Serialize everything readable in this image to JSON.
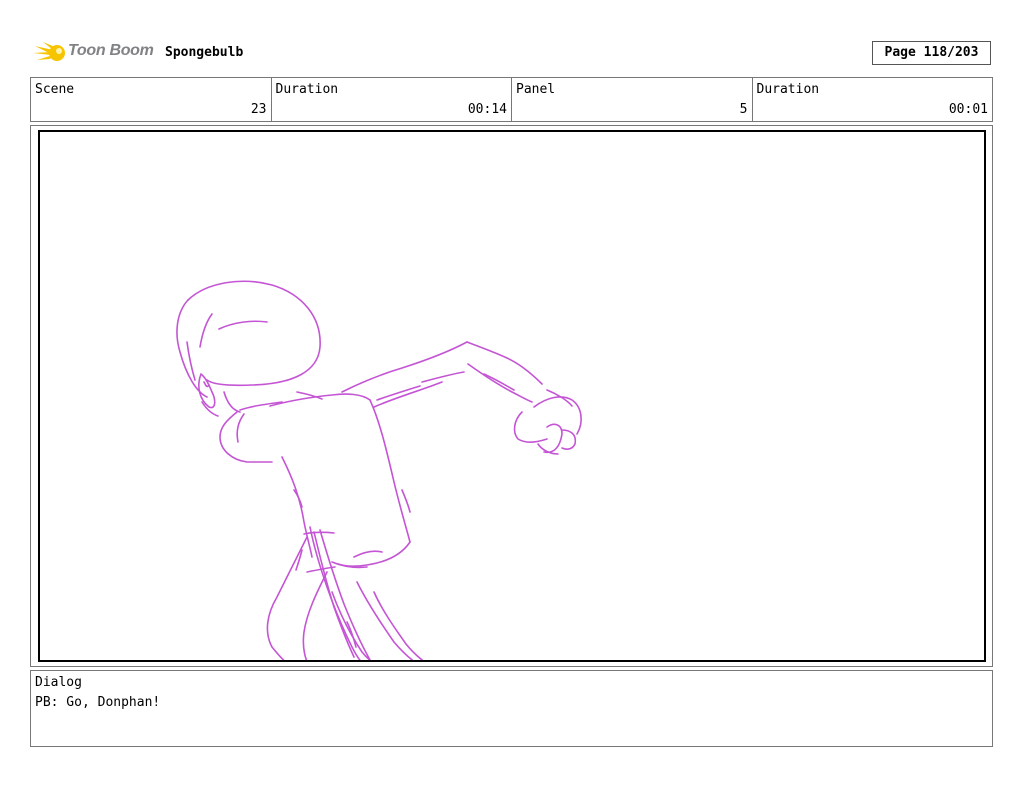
{
  "header": {
    "logo_text": "Toon Boom",
    "project_title": "Spongebulb",
    "page": "Page 118/203"
  },
  "info": {
    "scene_label": "Scene",
    "scene_value": "23",
    "duration1_label": "Duration",
    "duration1_value": "00:14",
    "panel_label": "Panel",
    "panel_value": "5",
    "duration2_label": "Duration",
    "duration2_value": "00:01"
  },
  "dialog": {
    "label": "Dialog",
    "text": "PB: Go, Donphan!"
  },
  "colors": {
    "sketch": "#c455d4",
    "logo_yellow": "#f6c500"
  }
}
